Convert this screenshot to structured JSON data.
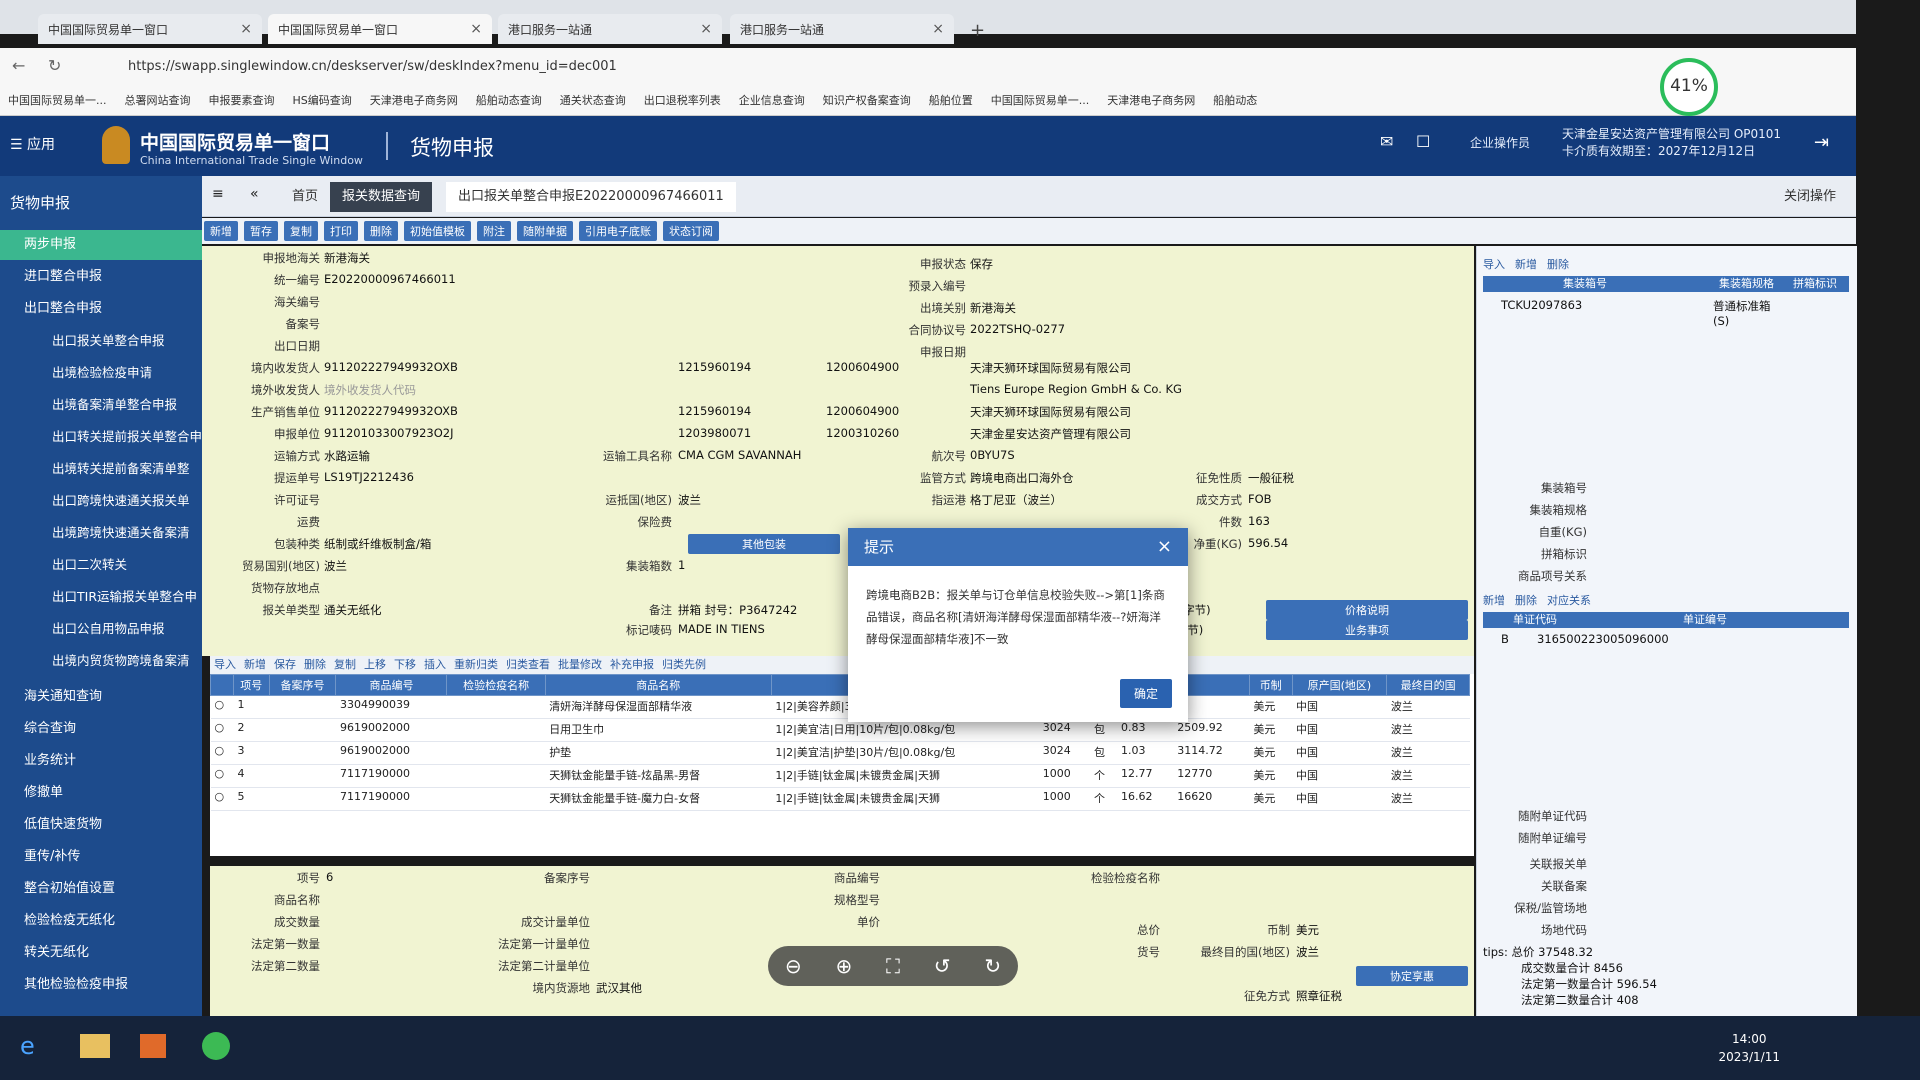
{
  "browser": {
    "tabs": [
      "中国国际贸易单一窗口",
      "中国国际贸易单一窗口",
      "港口服务一站通",
      "港口服务一站通"
    ],
    "url": "https://swapp.singlewindow.cn/deskserver/sw/deskIndex?menu_id=dec001",
    "bookmarks": [
      "中国国际贸易单一...",
      "总署网站查询",
      "申报要素查询",
      "HS编码查询",
      "天津港电子商务网",
      "船舶动态查询",
      "通关状态查询",
      "出口退税率列表",
      "企业信息查询",
      "知识产权备案查询",
      "船舶位置",
      "中国国际贸易单一...",
      "天津港电子商务网",
      "船舶动态"
    ],
    "battery": "41%"
  },
  "header": {
    "menu_label": "应用",
    "title_cn": "中国国际贸易单一窗口",
    "title_en": "China International Trade Single Window",
    "module": "货物申报",
    "user_role": "企业操作员",
    "company": "天津金星安达资产管理有限公司 OP0101",
    "cert_expiry": "卡介质有效期至：2027年12月12日"
  },
  "sidebar": {
    "title": "货物申报",
    "items": [
      "两步申报",
      "进口整合申报",
      "出口整合申报",
      "出口报关单整合申报",
      "出境检验检疫申请",
      "出境备案清单整合申报",
      "出口转关提前报关单整合申",
      "出境转关提前备案清单整",
      "出口跨境快速通关报关单",
      "出境跨境快速通关备案清",
      "出口二次转关",
      "出口TIR运输报关单整合申",
      "出口公自用物品申报",
      "出境内贸货物跨境备案清",
      "海关通知查询",
      "综合查询",
      "业务统计",
      "修撤单",
      "低值快速货物",
      "重传/补传",
      "整合初始值设置",
      "检验检疫无纸化",
      "转关无纸化",
      "其他检验检疫申报"
    ]
  },
  "pagetabs": {
    "home": "首页",
    "data_query": "报关数据查询",
    "current": "出口报关单整合申报E20220000967466011",
    "close_ops": "关闭操作"
  },
  "toolbar": [
    "新增",
    "暂存",
    "复制",
    "打印",
    "删除",
    "初始值模板",
    "附注",
    "随附单据",
    "引用电子底账",
    "状态订阅"
  ],
  "form": {
    "labels": {
      "customs": "申报地海关",
      "unified_no": "统一编号",
      "customs_no": "海关编号",
      "record_no": "备案号",
      "export_date": "出口日期",
      "consignee_dom": "境内收发货人",
      "consignee_for": "境外收发货人",
      "producer": "生产销售单位",
      "declarant": "申报单位",
      "transport": "运输方式",
      "bl_no": "提运单号",
      "license": "许可证号",
      "freight": "运费",
      "packing": "包装种类",
      "trade_country": "贸易国别(地区)",
      "storage": "货物存放地点",
      "decl_type": "报关单类型",
      "status": "申报状态",
      "pre_entry": "预录入编号",
      "exit_port": "出境关别",
      "contract": "合同协议号",
      "decl_date": "申报日期",
      "conveyance": "运输工具名称",
      "voyage": "航次号",
      "supervision": "监管方式",
      "levy": "征免性质",
      "dest_country": "运抵国(地区)",
      "port_dest": "指运港",
      "deal_mode": "成交方式",
      "insurance": "保险费",
      "pieces": "件数",
      "net_weight": "净重(KG)",
      "container_qty": "集装箱数",
      "remarks": "备注",
      "marks": "标记唛码",
      "other_pack": "其他包装",
      "price_desc": "价格说明",
      "business": "业务事项"
    },
    "values": {
      "customs": "新港海关",
      "unified_no": "E20220000967466011",
      "status": "保存",
      "exit_port": "新港海关",
      "contract": "2022TSHQ-0277",
      "consignee_dom_code": "911202227949932OXB",
      "consignee_dom_c1": "1215960194",
      "consignee_dom_c2": "1200604900",
      "consignee_dom_name": "天津天狮环球国际贸易有限公司",
      "consignee_for_ph": "境外收发货人代码",
      "consignee_for_name": "Tiens Europe Region GmbH & Co. KG",
      "producer_code": "911202227949932OXB",
      "producer_c1": "1215960194",
      "producer_c2": "1200604900",
      "producer_name": "天津天狮环球国际贸易有限公司",
      "declarant_code": "911201033007923O2J",
      "declarant_c1": "1203980071",
      "declarant_c2": "1200310260",
      "declarant_name": "天津金星安达资产管理有限公司",
      "transport": "水路运输",
      "conveyance": "CMA CGM SAVANNAH",
      "voyage": "0BYU7S",
      "bl_no": "LS19TJ2212436",
      "supervision": "跨境电商出口海外仓",
      "levy": "一般征税",
      "dest_country": "波兰",
      "port_dest": "格丁尼亚（波兰）",
      "deal_mode": "FOB",
      "pieces": "163",
      "net_weight": "596.54",
      "packing": "纸制或纤维板制盒/箱",
      "trade_country": "波兰",
      "container_qty": "1",
      "decl_type": "通关无纸化",
      "remarks": "拼箱 封号：P3647242",
      "marks": "MADE IN TIENS",
      "chars19": "(19字节)",
      "chars3": "(3字节)"
    }
  },
  "dialog": {
    "title": "提示",
    "message": "跨境电商B2B：报关单与订仓单信息校验失败-->第[1]条商品错误，商品名称[清妍海洋酵母保湿面部精华液--?妍海洋酵母保湿面部精华液]不一致",
    "ok": "确定"
  },
  "grid": {
    "toolbar": [
      "导入",
      "新增",
      "保存",
      "删除",
      "复制",
      "上移",
      "下移",
      "插入",
      "重新归类",
      "归类查看",
      "批量修改",
      "补充申报",
      "归类先例"
    ],
    "headers": [
      "项号",
      "备案序号",
      "商品编号",
      "检验检疫名称",
      "商品名称",
      "规格",
      "",
      "",
      "",
      "",
      "币制",
      "原产国(地区)",
      "最终目的国"
    ],
    "rows": [
      {
        "no": "1",
        "code": "3304990039",
        "name": "清妍海洋酵母保湿面部精华液",
        "spec": "1|2|美容养颜|30ml |清妍",
        "qty": "",
        "unit": "",
        "price": "",
        "total": "",
        "cur": "美元",
        "origin": "中国",
        "dest": "波兰"
      },
      {
        "no": "2",
        "code": "9619002000",
        "name": "日用卫生巾",
        "spec": "1|2|美宜洁|日用|10片/包|0.08kg/包",
        "qty": "3024",
        "unit": "包",
        "price": "0.83",
        "total": "2509.92",
        "cur": "美元",
        "origin": "中国",
        "dest": "波兰"
      },
      {
        "no": "3",
        "code": "9619002000",
        "name": "护垫",
        "spec": "1|2|美宜洁|护垫|30片/包|0.08kg/包",
        "qty": "3024",
        "unit": "包",
        "price": "1.03",
        "total": "3114.72",
        "cur": "美元",
        "origin": "中国",
        "dest": "波兰"
      },
      {
        "no": "4",
        "code": "7117190000",
        "name": "天狮钛金能量手链-炫晶黑-男督",
        "spec": "1|2|手链|钛金属|未镀贵金属|天狮",
        "qty": "1000",
        "unit": "个",
        "price": "12.77",
        "total": "12770",
        "cur": "美元",
        "origin": "中国",
        "dest": "波兰"
      },
      {
        "no": "5",
        "code": "7117190000",
        "name": "天狮钛金能量手链-魔力白-女督",
        "spec": "1|2|手链|钛金属|未镀贵金属|天狮",
        "qty": "1000",
        "unit": "个",
        "price": "16.62",
        "total": "16620",
        "cur": "美元",
        "origin": "中国",
        "dest": "波兰"
      }
    ]
  },
  "bottom": {
    "labels": [
      "项号",
      "商品名称",
      "成交数量",
      "法定第一数量",
      "法定第二数量",
      "备案序号",
      "成交计量单位",
      "法定第一计量单位",
      "法定第二计量单位",
      "境内货源地",
      "商品编号",
      "规格型号",
      "单价",
      "检验检疫名称",
      "总价",
      "货号",
      "币制",
      "最终目的国(地区)",
      "征免方式"
    ],
    "values": {
      "item_no": "6",
      "source": "武汉其他",
      "currency": "美元",
      "dest": "波兰",
      "levy": "照章征税",
      "agreement_btn": "协定享惠"
    }
  },
  "rightpanel": {
    "toolbar": [
      "导入",
      "新增",
      "删除"
    ],
    "container_headers": [
      "集装箱号",
      "集装箱规格",
      "拼箱标识"
    ],
    "container_row": {
      "no": "TCKU2097863",
      "spec": "普通标准箱 (S)"
    },
    "labels": [
      "集装箱号",
      "集装箱规格",
      "自重(KG)",
      "拼箱标识",
      "商品项号关系"
    ],
    "doc_toolbar": [
      "新增",
      "删除",
      "对应关系"
    ],
    "doc_headers": [
      "单证代码",
      "单证编号"
    ],
    "doc_row": {
      "code": "B",
      "no": "316500223005096000"
    },
    "labels2": [
      "随附单证代码",
      "随附单证编号",
      "关联报关单",
      "关联备案",
      "保税/监管场地",
      "场地代码"
    ],
    "tips": [
      "tips: 总价 37548.32",
      "成交数量合计 8456",
      "法定第一数量合计 596.54",
      "法定第二数量合计 408"
    ]
  },
  "taskbar": {
    "time": "14:00",
    "date": "2023/1/11"
  }
}
